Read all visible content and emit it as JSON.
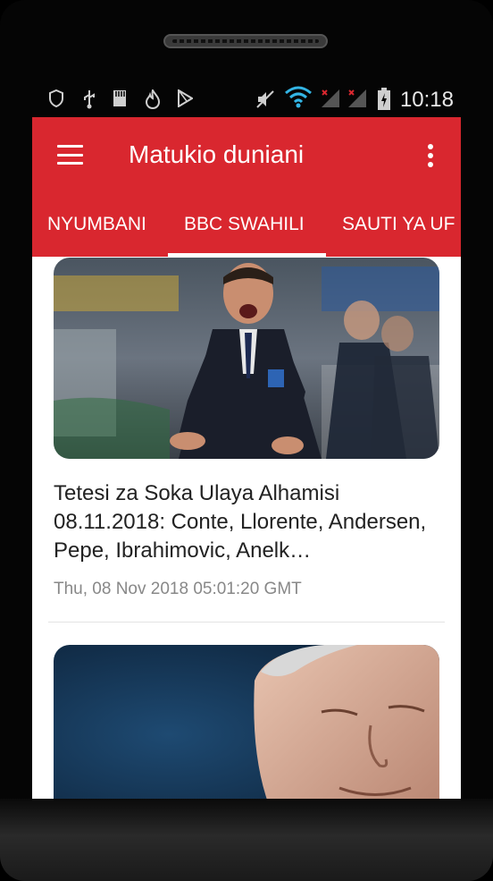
{
  "status_bar": {
    "time": "10:18",
    "icons": [
      "shield-icon",
      "usb-icon",
      "sdcard-icon",
      "flame-icon",
      "play-icon",
      "mute-icon",
      "wifi-icon",
      "signal-icon",
      "signal-icon",
      "battery-icon"
    ]
  },
  "app_bar": {
    "title": "Matukio duniani",
    "menu_icon": "hamburger-menu-icon",
    "more_icon": "more-vert-icon",
    "color": "#d9272f"
  },
  "tabs": [
    {
      "label": "NYUMBANI",
      "selected": false
    },
    {
      "label": "BBC SWAHILI",
      "selected": true
    },
    {
      "label": "SAUTI YA UF",
      "selected": false
    }
  ],
  "articles": [
    {
      "title": "Tetesi za Soka Ulaya Alhamisi 08.11.2018: Conte, Llorente, Andersen, Pepe, Ibrahimovic, Anelk…",
      "date": "Thu, 08 Nov 2018 05:01:20 GMT",
      "image": "football-manager-photo"
    },
    {
      "title": "",
      "date": "",
      "image": "man-portrait-photo"
    }
  ]
}
